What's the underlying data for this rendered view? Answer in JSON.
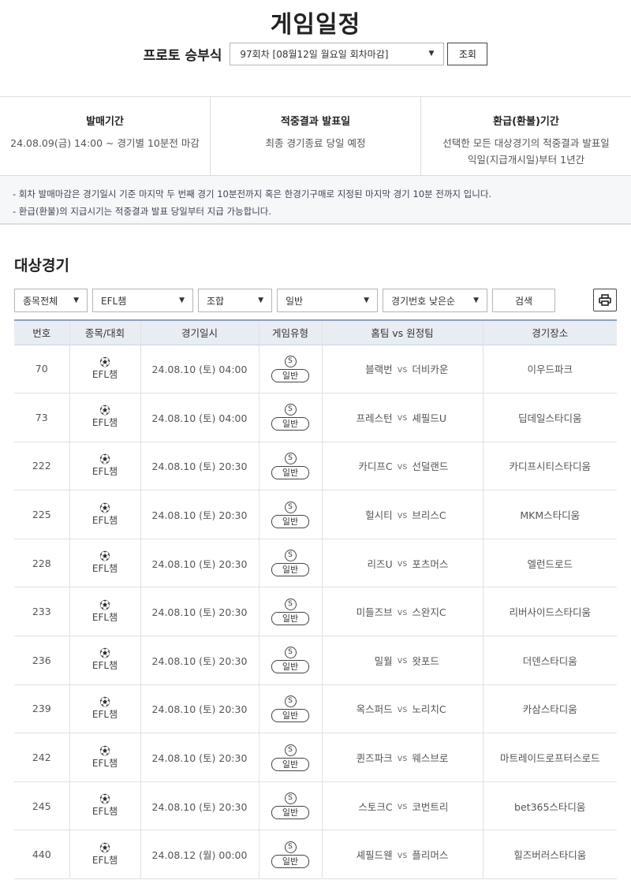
{
  "header": {
    "title": "게임일정",
    "round_label": "프로토 승부식",
    "round_select": "97회차 [08월12일 월요일 회차마감]",
    "search_button": "조회"
  },
  "info": [
    {
      "title": "발매기간",
      "lines": [
        "24.08.09(금) 14:00 ~ 경기별 10분전 마감"
      ]
    },
    {
      "title": "적중결과 발표일",
      "lines": [
        "최종 경기종료 당일 예정"
      ]
    },
    {
      "title": "환급(환불)기간",
      "lines": [
        "선택한 모든 대상경기의 적중결과 발표일",
        "익일(지급개시일)부터 1년간"
      ]
    }
  ],
  "notices": [
    "- 회차 발매마감은 경기일시 기준 마지막 두 번째 경기 10분전까지 혹은 한경기구매로 지정된 마지막 경기 10분 전까지 입니다.",
    "- 환급(환불)의 지급시기는 적중결과 발표 당일부터 지급 가능합니다."
  ],
  "section_title": "대상경기",
  "filters": {
    "sport": "종목전체",
    "league": "EFL챔",
    "bet_kind": "조합",
    "game_kind": "일반",
    "sort": "경기번호 낮은순",
    "search_button": "검색"
  },
  "table": {
    "headers": [
      "번호",
      "종목/대회",
      "경기일시",
      "게임유형",
      "홈팀 vs 원정팀",
      "경기장소"
    ],
    "vs": "vs",
    "type_icon": "S",
    "rows": [
      {
        "no": "70",
        "league": "EFL챔",
        "datetime": "24.08.10 (토) 04:00",
        "type": "일반",
        "home": "블랙번",
        "away": "더비카운",
        "venue": "이우드파크"
      },
      {
        "no": "73",
        "league": "EFL챔",
        "datetime": "24.08.10 (토) 04:00",
        "type": "일반",
        "home": "프레스턴",
        "away": "셰필드U",
        "venue": "딥데일스타디움"
      },
      {
        "no": "222",
        "league": "EFL챔",
        "datetime": "24.08.10 (토) 20:30",
        "type": "일반",
        "home": "카디프C",
        "away": "선덜랜드",
        "venue": "카디프시티스타디움"
      },
      {
        "no": "225",
        "league": "EFL챔",
        "datetime": "24.08.10 (토) 20:30",
        "type": "일반",
        "home": "헐시티",
        "away": "브리스C",
        "venue": "MKM스타디움"
      },
      {
        "no": "228",
        "league": "EFL챔",
        "datetime": "24.08.10 (토) 20:30",
        "type": "일반",
        "home": "리즈U",
        "away": "포츠머스",
        "venue": "엘런드로드"
      },
      {
        "no": "233",
        "league": "EFL챔",
        "datetime": "24.08.10 (토) 20:30",
        "type": "일반",
        "home": "미들즈브",
        "away": "스완지C",
        "venue": "리버사이드스타디움"
      },
      {
        "no": "236",
        "league": "EFL챔",
        "datetime": "24.08.10 (토) 20:30",
        "type": "일반",
        "home": "밀월",
        "away": "왓포드",
        "venue": "더덴스타디움"
      },
      {
        "no": "239",
        "league": "EFL챔",
        "datetime": "24.08.10 (토) 20:30",
        "type": "일반",
        "home": "옥스퍼드",
        "away": "노리치C",
        "venue": "카삼스타디움"
      },
      {
        "no": "242",
        "league": "EFL챔",
        "datetime": "24.08.10 (토) 20:30",
        "type": "일반",
        "home": "퀸즈파크",
        "away": "웨스브로",
        "venue": "마트레이드로프터스로드"
      },
      {
        "no": "245",
        "league": "EFL챔",
        "datetime": "24.08.10 (토) 20:30",
        "type": "일반",
        "home": "스토크C",
        "away": "코번트리",
        "venue": "bet365스타디움"
      },
      {
        "no": "440",
        "league": "EFL챔",
        "datetime": "24.08.12 (월) 00:00",
        "type": "일반",
        "home": "셰필드웬",
        "away": "플리머스",
        "venue": "힐즈버러스타디움"
      }
    ]
  }
}
